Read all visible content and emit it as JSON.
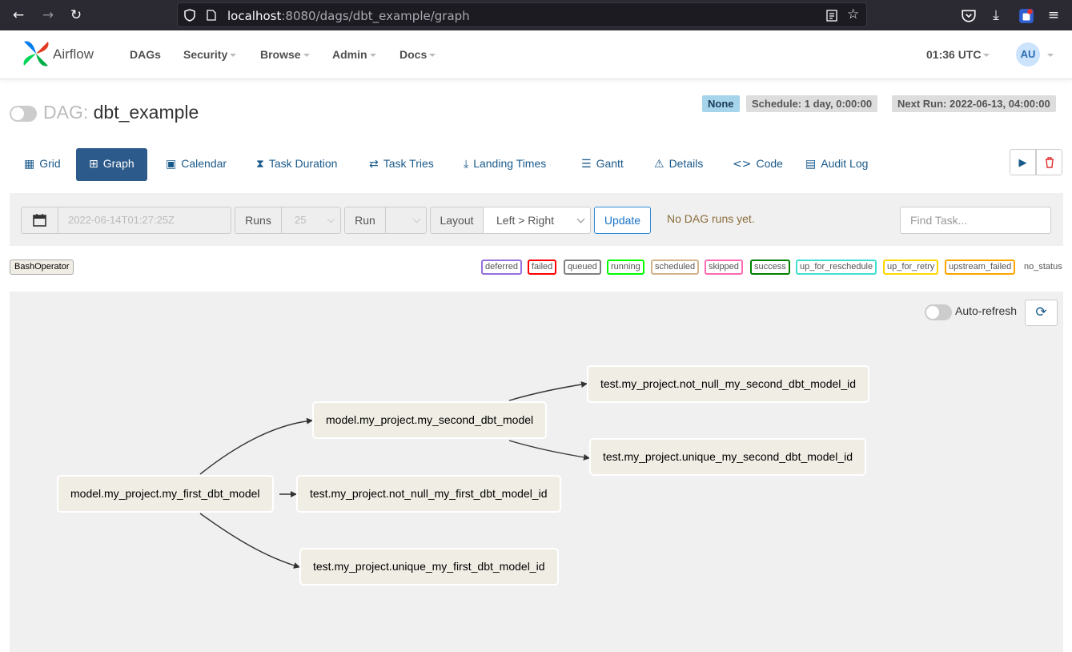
{
  "browser": {
    "url_host": "localhost",
    "url_rest": ":8080/dags/dbt_example/graph"
  },
  "nav": {
    "brand": "Airflow",
    "items": [
      "DAGs",
      "Security",
      "Browse",
      "Admin",
      "Docs"
    ],
    "time": "01:36 UTC",
    "user_initials": "AU"
  },
  "header": {
    "dag_prefix": "DAG:",
    "dag_id": "dbt_example",
    "badge_none": "None",
    "schedule": "Schedule: 1 day, 0:00:00",
    "next_run": "Next Run: 2022-06-13, 04:00:00"
  },
  "tabs": [
    "Grid",
    "Graph",
    "Calendar",
    "Task Duration",
    "Task Tries",
    "Landing Times",
    "Gantt",
    "Details",
    "Code",
    "Audit Log"
  ],
  "controls": {
    "base_date": "2022-06-14T01:27:25Z",
    "runs_label": "Runs",
    "runs_value": "25",
    "run_label": "Run",
    "layout_label": "Layout",
    "layout_value": "Left > Right",
    "update": "Update",
    "no_runs": "No DAG runs yet.",
    "find_placeholder": "Find Task..."
  },
  "legend": {
    "operator": "BashOperator",
    "states": [
      {
        "label": "deferred",
        "color": "#9370db"
      },
      {
        "label": "failed",
        "color": "#ff0000"
      },
      {
        "label": "queued",
        "color": "#808080"
      },
      {
        "label": "running",
        "color": "#00ff00"
      },
      {
        "label": "scheduled",
        "color": "#d2b48c"
      },
      {
        "label": "skipped",
        "color": "#ff69b4"
      },
      {
        "label": "success",
        "color": "#008000"
      },
      {
        "label": "up_for_reschedule",
        "color": "#40e0d0"
      },
      {
        "label": "up_for_retry",
        "color": "#ffd700"
      },
      {
        "label": "upstream_failed",
        "color": "#ffa500"
      }
    ],
    "no_status": "no_status"
  },
  "graph": {
    "auto_refresh": "Auto-refresh",
    "nodes": [
      "model.my_project.my_first_dbt_model",
      "model.my_project.my_second_dbt_model",
      "test.my_project.not_null_my_first_dbt_model_id",
      "test.my_project.unique_my_first_dbt_model_id",
      "test.my_project.not_null_my_second_dbt_model_id",
      "test.my_project.unique_my_second_dbt_model_id"
    ]
  },
  "colors": {
    "primary": "#2c5a8a",
    "node_fill": "#f0ede4"
  }
}
